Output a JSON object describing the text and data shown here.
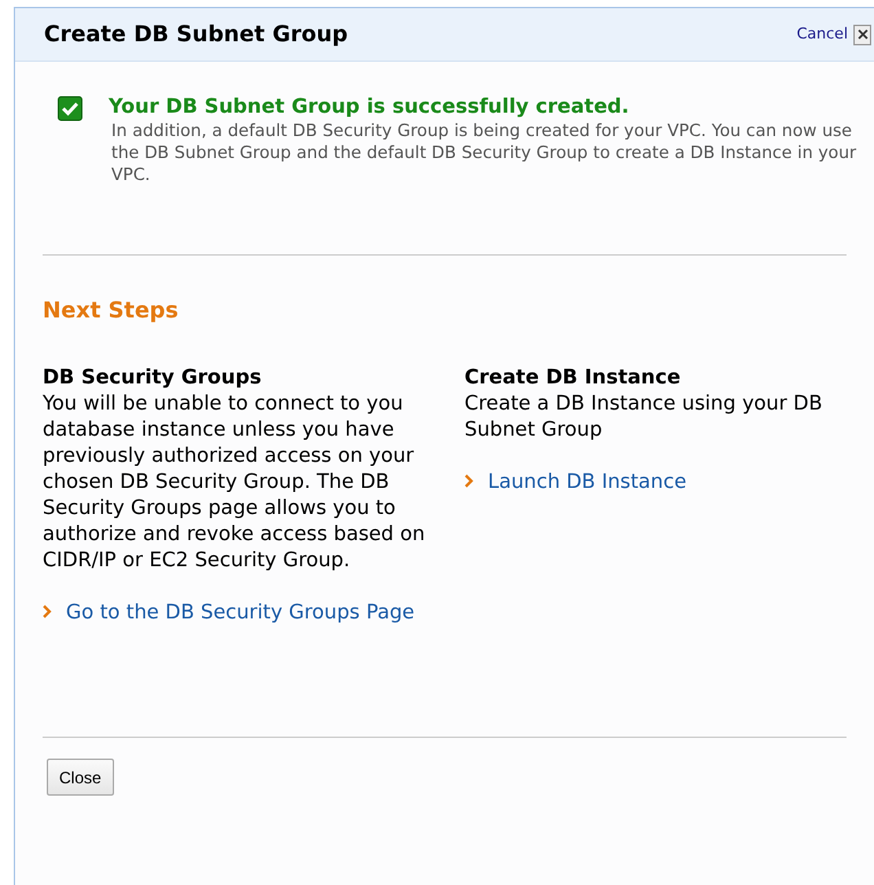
{
  "dialog": {
    "title": "Create DB Subnet Group",
    "cancel": "Cancel"
  },
  "success": {
    "checked": true,
    "heading": "Your DB Subnet Group is successfully created.",
    "message": "In addition, a default DB Security Group is being created for your VPC. You can now use the DB Subnet Group and the default DB Security Group to create a DB Instance in your VPC."
  },
  "next_steps": {
    "heading": "Next Steps",
    "columns": [
      {
        "title": "DB Security Groups",
        "text": "You will be unable to connect to you database instance unless you have previously authorized access on your chosen DB Security Group. The DB Security Groups page allows you to authorize and revoke access based on CIDR/IP or EC2 Security Group.",
        "link": "Go to the DB Security Groups Page"
      },
      {
        "title": "Create DB Instance",
        "text": "Create a DB Instance using your DB Subnet Group",
        "link": "Launch DB Instance"
      }
    ]
  },
  "buttons": [
    "Close"
  ]
}
